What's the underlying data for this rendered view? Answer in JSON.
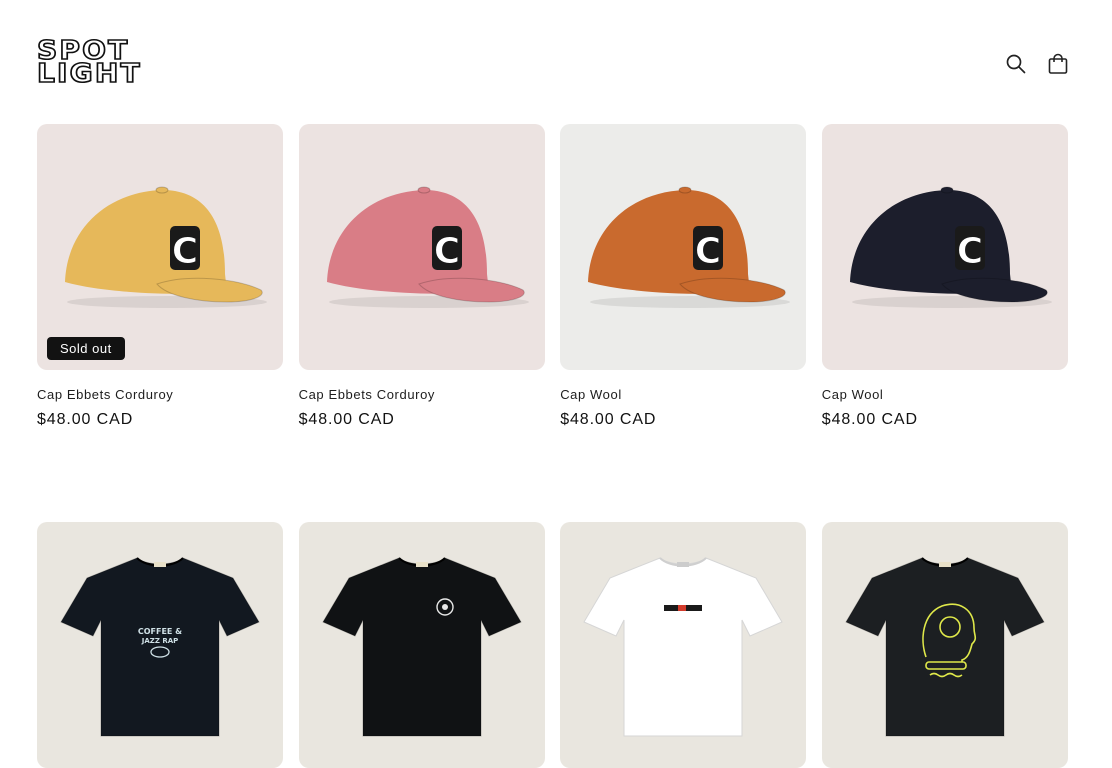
{
  "header": {
    "logo_line1": "SPOT",
    "logo_line2": "LIGHT",
    "search_icon": "search-icon",
    "cart_icon": "cart-icon"
  },
  "products": [
    {
      "title": "Cap Ebbets Corduroy",
      "price": "$48.00 CAD",
      "badge": "Sold out",
      "color": "#e6b85a",
      "bg": "#ece3e1"
    },
    {
      "title": "Cap Ebbets Corduroy",
      "price": "$48.00 CAD",
      "color": "#d97d86",
      "bg": "#ece3e1"
    },
    {
      "title": "Cap Wool",
      "price": "$48.00 CAD",
      "color": "#c96a2e",
      "bg": "#ececea"
    },
    {
      "title": "Cap Wool",
      "price": "$48.00 CAD",
      "color": "#1c1e2c",
      "bg": "#ece3e1"
    },
    {
      "color": "#121820",
      "bg": "#e9e6df"
    },
    {
      "color": "#101214",
      "bg": "#e9e6df"
    },
    {
      "color": "#ffffff",
      "bg": "#e9e6df"
    },
    {
      "color": "#1c1f22",
      "bg": "#e9e6df"
    }
  ]
}
